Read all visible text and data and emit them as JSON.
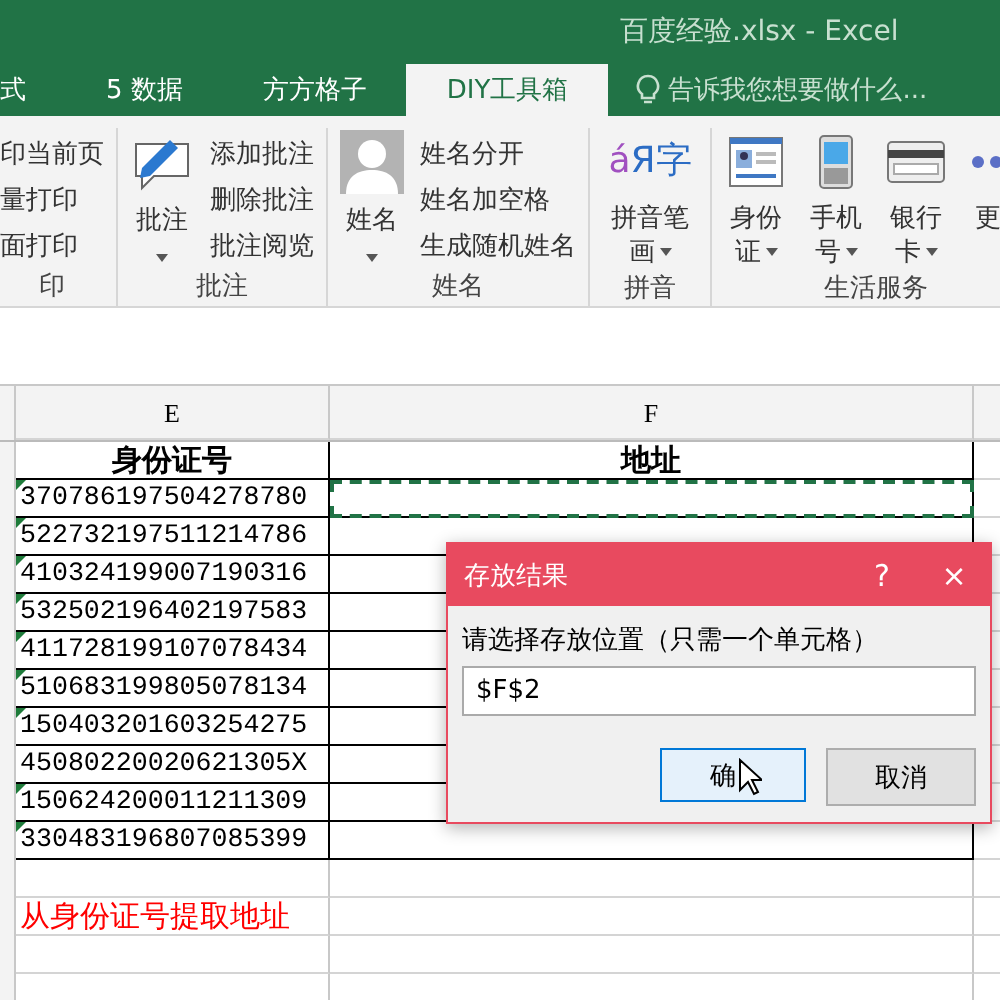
{
  "window": {
    "title": "百度经验.xlsx - Excel"
  },
  "tabs": [
    {
      "label": "式",
      "selected": false
    },
    {
      "label": "5 数据",
      "selected": false
    },
    {
      "label": "方方格子",
      "selected": false
    },
    {
      "label": "DIY工具箱",
      "selected": true
    }
  ],
  "tell_me": {
    "placeholder": "告诉我您想要做什么..."
  },
  "ribbon": {
    "groups": [
      {
        "label": "印",
        "kind": "list",
        "items": [
          "印当前页",
          "量打印",
          "面打印"
        ]
      },
      {
        "label": "批注",
        "kind": "big_list",
        "big": {
          "label": "批注"
        },
        "items": [
          "添加批注",
          "删除批注",
          "批注阅览"
        ]
      },
      {
        "label": "姓名",
        "kind": "big_list",
        "big": {
          "label": "姓名"
        },
        "items": [
          "姓名分开",
          "姓名加空格",
          "生成随机姓名"
        ]
      },
      {
        "label": "拼音",
        "kind": "bigs",
        "bigs": [
          {
            "label": "拼音笔画",
            "glyphs": [
              "á",
              "Я",
              "字"
            ]
          }
        ]
      },
      {
        "label": "生活服务",
        "kind": "bigs",
        "bigs": [
          {
            "label": "身份证"
          },
          {
            "label": "手机号"
          },
          {
            "label": "银行卡"
          },
          {
            "label": "更"
          }
        ]
      }
    ]
  },
  "sheet": {
    "columns": [
      "E",
      "F"
    ],
    "header": [
      "身份证号",
      "地址"
    ],
    "rows": [
      {
        "id": "370786197504278780",
        "flagged": true,
        "marquee": true
      },
      {
        "id": "522732197511214786",
        "flagged": true,
        "marquee": false
      },
      {
        "id": "410324199007190316",
        "flagged": true,
        "marquee": false
      },
      {
        "id": "532502196402197583",
        "flagged": true,
        "marquee": false
      },
      {
        "id": "411728199107078434",
        "flagged": true,
        "marquee": false
      },
      {
        "id": "510683199805078134",
        "flagged": true,
        "marquee": false
      },
      {
        "id": "150403201603254275",
        "flagged": true,
        "marquee": false
      },
      {
        "id": "45080220020621305X",
        "flagged": false,
        "marquee": false
      },
      {
        "id": "150624200011211309",
        "flagged": true,
        "marquee": false
      },
      {
        "id": "330483196807085399",
        "flagged": true,
        "marquee": false
      }
    ],
    "note": "从身份证号提取地址"
  },
  "dialog": {
    "title": "存放结果",
    "help": "?",
    "close": "×",
    "prompt": "请选择存放位置（只需一个单元格）",
    "value": "$F$2",
    "buttons": [
      {
        "label": "确",
        "selected": true
      },
      {
        "label": "取消",
        "selected": false
      }
    ]
  }
}
